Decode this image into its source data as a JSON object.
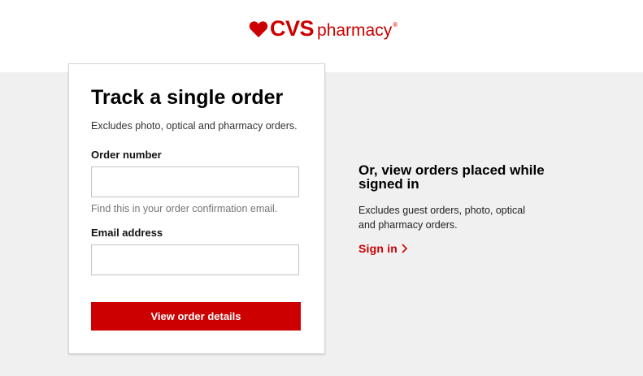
{
  "header": {
    "logo": {
      "brand": "CVS",
      "sub": "pharmacy",
      "registered": "®",
      "icon": "heart-icon",
      "color": "#cc0000"
    }
  },
  "track_card": {
    "title": "Track a single order",
    "subtitle": "Excludes photo, optical and pharmacy orders.",
    "order_number": {
      "label": "Order number",
      "value": "",
      "placeholder": "",
      "hint": "Find this in your order confirmation email."
    },
    "email": {
      "label": "Email address",
      "value": "",
      "placeholder": ""
    },
    "submit_label": "View order details"
  },
  "signed_in": {
    "title": "Or, view orders placed while signed in",
    "text": "Excludes guest orders, photo, optical and pharmacy orders.",
    "link_label": "Sign in",
    "link_icon": "chevron-right-icon"
  },
  "colors": {
    "brand_red": "#cc0000",
    "background_gray": "#f0f0f0"
  }
}
